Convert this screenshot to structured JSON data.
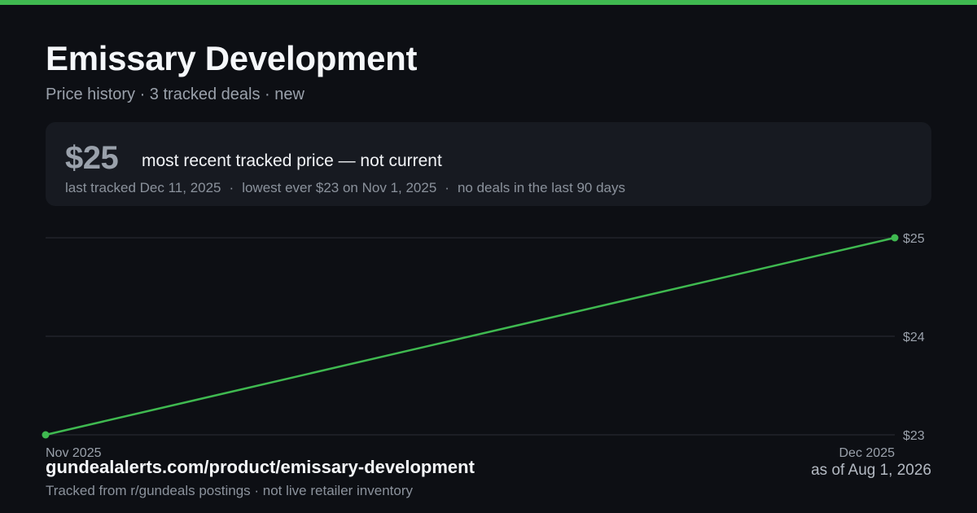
{
  "header": {
    "title": "Emissary Development",
    "subtitle": "Price history · 3 tracked deals · new"
  },
  "summary": {
    "price": "$25",
    "price_note": "most recent tracked price — not current",
    "last_tracked": "last tracked Dec 11, 2025",
    "lowest": "lowest ever $23 on Nov 1, 2025",
    "recent": "no deals in the last 90 days",
    "separator": "·"
  },
  "footer": {
    "url": "gundealalerts.com/product/emissary-development",
    "note": "Tracked from r/gundeals postings · not live retailer inventory",
    "as_of": "as of Aug 1, 2026"
  },
  "colors": {
    "accent": "#3fb950",
    "background": "#0d0f14",
    "card": "#171a21",
    "gridline": "#2a2e36",
    "tick_text": "#9aa1ab"
  },
  "chart_data": {
    "type": "line",
    "series": [
      {
        "x": [
          "2025-11-01",
          "2025-12-11"
        ],
        "values": [
          23,
          25
        ]
      }
    ],
    "xticks": [
      "Nov 2025",
      "Dec 2025"
    ],
    "yticks": [
      "$23",
      "$24",
      "$25"
    ],
    "ytick_values": [
      23,
      24,
      25
    ],
    "ylim": [
      23,
      25
    ],
    "grid": true,
    "legend": "none"
  }
}
